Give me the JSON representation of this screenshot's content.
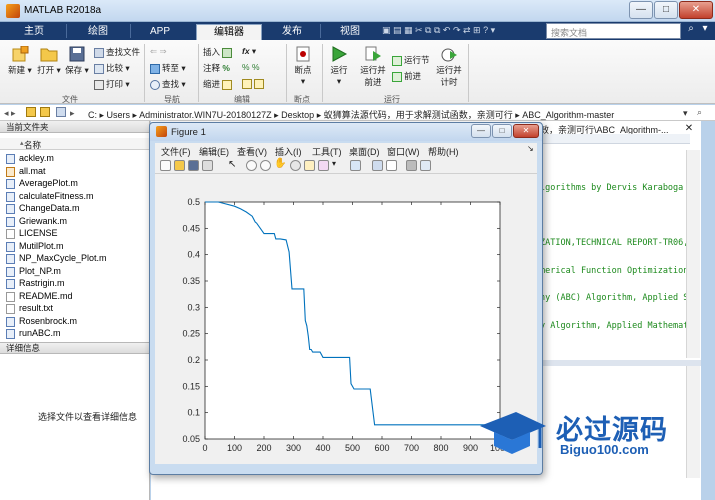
{
  "window": {
    "title": "MATLAB R2018a"
  },
  "tabs": [
    {
      "label": "主页"
    },
    {
      "label": "绘图"
    },
    {
      "label": "APP"
    },
    {
      "label": "编辑器",
      "active": true
    },
    {
      "label": "发布"
    },
    {
      "label": "视图"
    }
  ],
  "search": {
    "placeholder": "搜索文档"
  },
  "ribbon": {
    "file": {
      "new": "新建",
      "open": "打开",
      "save": "保存",
      "find_files": "查找文件",
      "compare": "比较",
      "print": "打印",
      "group": "文件"
    },
    "nav": {
      "goto": "转至",
      "find": "查找",
      "group": "导航"
    },
    "edit": {
      "insert": "插入",
      "comment": "注释",
      "indent": "缩进",
      "fx": "fx",
      "group": "编辑"
    },
    "breakpoints": {
      "label": "断点",
      "group": "断点"
    },
    "run": {
      "run": "运行",
      "run_advance_1": "运行并",
      "run_advance_2": "前进",
      "run_section": "运行节",
      "advance": "前进",
      "run_time_1": "运行并",
      "run_time_2": "计时",
      "group": "运行"
    }
  },
  "address": {
    "drive": "C:",
    "segments": [
      "Users",
      "Administrator.WIN7U-20180127Z",
      "Desktop",
      "蚁狮算法源代码，用于求解测试函数，亲测可行",
      "ABC_Algorithm-master"
    ]
  },
  "current_folder": {
    "title": "当前文件夹",
    "name_col": "名称",
    "files": [
      {
        "name": "ackley.m",
        "type": "m"
      },
      {
        "name": "all.mat",
        "type": "mat"
      },
      {
        "name": "AveragePlot.m",
        "type": "m"
      },
      {
        "name": "calculateFitness.m",
        "type": "m"
      },
      {
        "name": "ChangeData.m",
        "type": "m"
      },
      {
        "name": "Griewank.m",
        "type": "m"
      },
      {
        "name": "LICENSE",
        "type": "txt"
      },
      {
        "name": "MutilPlot.m",
        "type": "m"
      },
      {
        "name": "NP_MaxCycle_Plot.m",
        "type": "m"
      },
      {
        "name": "Plot_NP.m",
        "type": "m"
      },
      {
        "name": "Rastrigin.m",
        "type": "m"
      },
      {
        "name": "README.md",
        "type": "txt"
      },
      {
        "name": "result.txt",
        "type": "txt"
      },
      {
        "name": "Rosenbrock.m",
        "type": "m"
      },
      {
        "name": "runABC.m",
        "type": "m"
      }
    ]
  },
  "details": {
    "title": "详细信息",
    "hint": "选择文件以查看详细信息"
  },
  "editor": {
    "path_tail": "效，亲测可行\\ABC_Algorithm-...",
    "lines": [
      "lgorithms by Dervis Karaboga",
      "ZATION,TECHNICAL REPORT-TR06,",
      "merical Function Optimization",
      "ny (ABC) Algorithm, Applied S",
      "y Algorithm,  Applied Mathemat"
    ]
  },
  "figure": {
    "title": "Figure 1",
    "menu": [
      "文件(F)",
      "编辑(E)",
      "查看(V)",
      "插入(I)",
      "工具(T)",
      "桌面(D)",
      "窗口(W)",
      "帮助(H)"
    ]
  },
  "chart_data": {
    "type": "line",
    "xlim": [
      0,
      1000
    ],
    "ylim": [
      0.05,
      0.5
    ],
    "xticks": [
      0,
      100,
      200,
      300,
      400,
      500,
      600,
      700,
      800,
      900,
      1000
    ],
    "xtick_labels": [
      "0",
      "100",
      "200",
      "300",
      "400",
      "500",
      "600",
      "700",
      "800",
      "900",
      "1000"
    ],
    "yticks": [
      0.05,
      0.1,
      0.15,
      0.2,
      0.25,
      0.3,
      0.35,
      0.4,
      0.45,
      0.5
    ],
    "ytick_labels": [
      "0.05",
      "0.1",
      "0.15",
      "0.2",
      "0.25",
      "0.3",
      "0.35",
      "0.4",
      "0.45",
      "0.5"
    ],
    "color": "#0072bd",
    "series": [
      {
        "x": [
          0,
          45,
          60,
          100,
          120,
          140,
          160,
          170,
          175,
          200,
          235,
          240,
          255,
          275,
          285,
          295,
          335,
          340,
          345,
          350,
          355,
          360,
          365,
          375,
          390,
          400,
          430,
          450,
          490,
          495,
          505,
          540,
          560,
          570,
          575,
          1000
        ],
        "y": [
          0.5,
          0.5,
          0.498,
          0.492,
          0.487,
          0.481,
          0.473,
          0.462,
          0.46,
          0.44,
          0.44,
          0.43,
          0.43,
          0.428,
          0.405,
          0.335,
          0.335,
          0.275,
          0.265,
          0.245,
          0.22,
          0.22,
          0.215,
          0.215,
          0.215,
          0.205,
          0.205,
          0.205,
          0.205,
          0.155,
          0.145,
          0.145,
          0.145,
          0.1,
          0.077,
          0.077
        ]
      }
    ]
  },
  "watermark": {
    "brand": "必过源码",
    "site": "Biguo100.com"
  }
}
